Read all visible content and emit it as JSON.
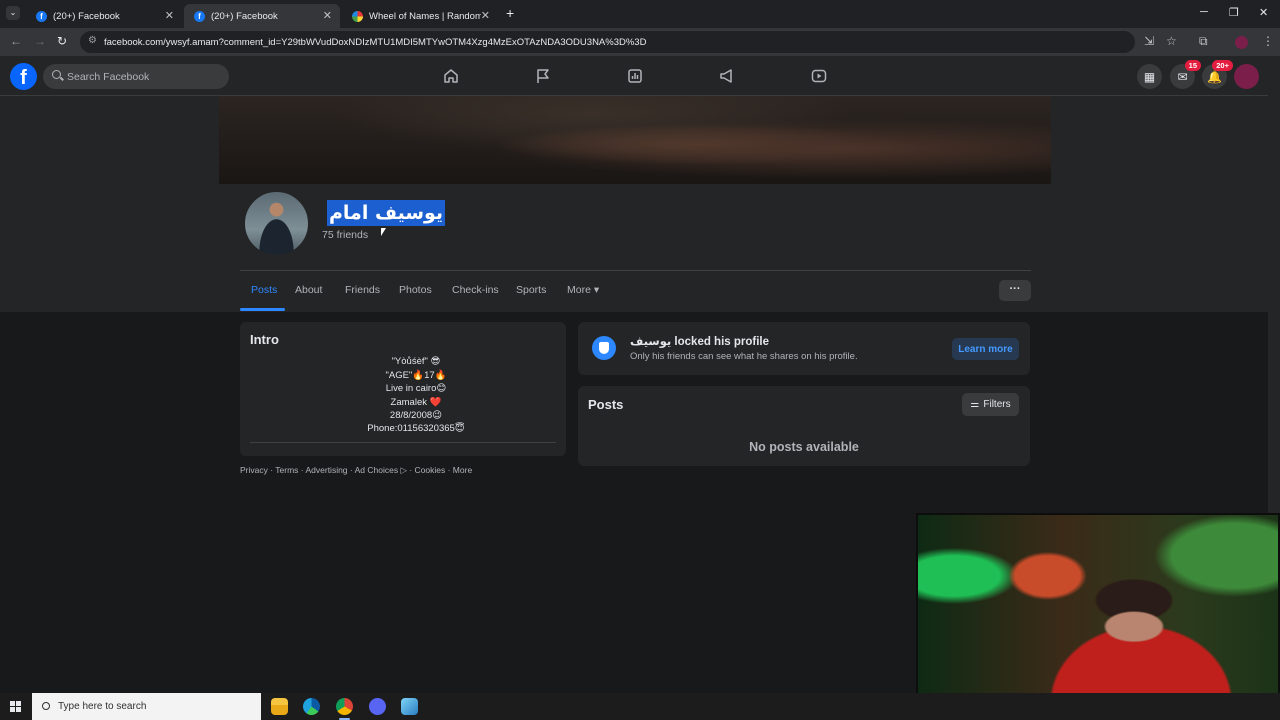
{
  "browser": {
    "tabs": [
      {
        "title": "(20+) Facebook",
        "favicon": "facebook-icon",
        "active": false
      },
      {
        "title": "(20+) Facebook",
        "favicon": "facebook-icon",
        "active": true
      },
      {
        "title": "Wheel of Names | Random nam",
        "favicon": "wheel-icon",
        "active": false
      }
    ],
    "new_tab": "+",
    "url": "facebook.com/ywsyf.amam?comment_id=Y29tbWVudDoxNDIzMTU1MDI5MTYwOTM4Xzg4MzExOTAzNDA3ODU3NA%3D%3D"
  },
  "facebook": {
    "search_placeholder": "Search Facebook",
    "badges": {
      "messenger": "15",
      "notifications": "20+"
    },
    "accent_color": "#2d88ff"
  },
  "profile": {
    "name": "يوسيف امام",
    "friends": "75 friends",
    "tabs": [
      "Posts",
      "About",
      "Friends",
      "Photos",
      "Check-ins",
      "Sports",
      "More ▾"
    ],
    "active_tab": "Posts",
    "more_options": "···"
  },
  "intro": {
    "title": "Intro",
    "bio": [
      "\"Yòůśèf\" 😎",
      "\"AGE\"🔥17🔥",
      "Live in cairo😊",
      "Zamalek ❤️",
      "28/8/2008😉",
      "Phone:01156320365😇"
    ]
  },
  "footer": "Privacy · Terms · Advertising · Ad Choices ▷ · Cookies · More",
  "locked": {
    "title": "يوسيف locked his profile",
    "subtitle": "Only his friends can see what he shares on his profile.",
    "button": "Learn more"
  },
  "posts": {
    "title": "Posts",
    "filters": "Filters",
    "empty": "No posts available"
  },
  "taskbar": {
    "search_placeholder": "Type here to search"
  }
}
